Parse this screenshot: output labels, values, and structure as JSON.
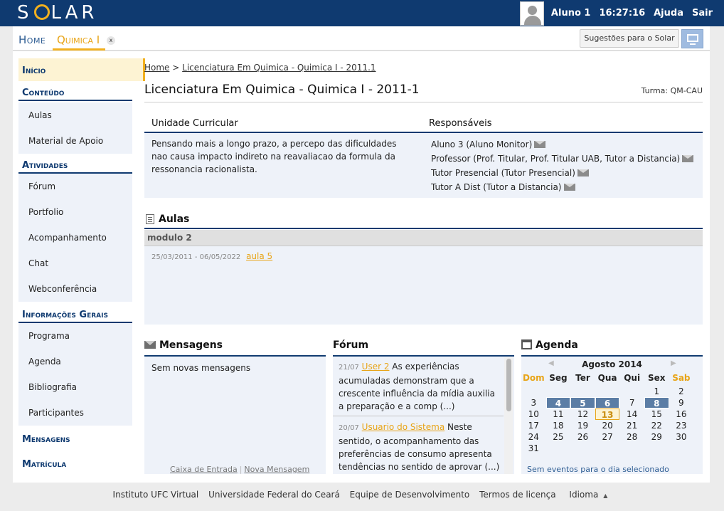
{
  "app": {
    "logo_text": "SOLAR"
  },
  "user": {
    "name": "Aluno 1",
    "time": "16:27:16",
    "help": "Ajuda",
    "logout": "Sair"
  },
  "tabs": {
    "home": "Home",
    "course": "Quimica I",
    "close": "x"
  },
  "toolbar": {
    "suggestions": "Sugestões para o Solar 2.0"
  },
  "sidebar": {
    "start": "Início",
    "content_title": "Conteúdo",
    "content_items": [
      "Aulas",
      "Material de Apoio"
    ],
    "activities_title": "Atividades",
    "activities_items": [
      "Fórum",
      "Portfolio",
      "Acompanhamento",
      "Chat",
      "Webconferência"
    ],
    "info_title": "Informações Gerais",
    "info_items": [
      "Programa",
      "Agenda",
      "Bibliografia",
      "Participantes"
    ],
    "messages": "Mensagens",
    "enrollment": "Matrícula"
  },
  "breadcrumb": {
    "home": "Home",
    "sep": ">",
    "course": "Licenciatura Em Quimica - Quimica I - 2011.1"
  },
  "page": {
    "title": "Licenciatura Em Quimica - Quimica I - 2011-1",
    "turma": "Turma:  QM-CAU"
  },
  "curricular": {
    "unit_header": "Unidade Curricular",
    "resp_header": "Responsáveis",
    "description": "Pensando mais a longo prazo, a percepo das dificuldades nao causa impacto indireto na reavaliacao da formula da ressonancia racionalista.",
    "responsibles": [
      "Aluno 3 (Aluno Monitor)",
      "Professor (Prof. Titular, Prof. Titular UAB, Tutor a Distancia)",
      "Tutor Presencial (Tutor Presencial)",
      "Tutor A Dist (Tutor a Distancia)"
    ]
  },
  "aulas": {
    "title": "Aulas",
    "module": "modulo 2",
    "date_range": "25/03/2011 - 06/05/2022",
    "lesson": "aula 5"
  },
  "messages": {
    "title": "Mensagens",
    "empty": "Sem novas mensagens",
    "inbox": "Caixa de Entrada",
    "new": "Nova Mensagem",
    "sep": "|"
  },
  "forum": {
    "title": "Fórum",
    "posts": [
      {
        "date": "21/07",
        "user": "User 2",
        "text": "As experiências acumuladas demonstram que a crescente influência da mídia auxilia a preparação e a comp (...)"
      },
      {
        "date": "20/07",
        "user": "Usuario do Sistema",
        "text": "Neste sentido, o acompanhamento das preferências de consumo apresenta tendências no sentido de aprovar (...)"
      }
    ]
  },
  "agenda": {
    "title": "Agenda",
    "month": "Agosto 2014",
    "prev": "◀",
    "next": "▶",
    "weekdays": [
      "Dom",
      "Seg",
      "Ter",
      "Qua",
      "Qui",
      "Sex",
      "Sab"
    ],
    "weeks": [
      [
        "",
        "",
        "",
        "",
        "",
        "1",
        "2"
      ],
      [
        "3",
        "4",
        "5",
        "6",
        "7",
        "8",
        "9"
      ],
      [
        "10",
        "11",
        "12",
        "13",
        "14",
        "15",
        "16"
      ],
      [
        "17",
        "18",
        "19",
        "20",
        "21",
        "22",
        "23"
      ],
      [
        "24",
        "25",
        "26",
        "27",
        "28",
        "29",
        "30"
      ],
      [
        "31",
        "",
        "",
        "",
        "",
        "",
        ""
      ]
    ],
    "event_days": [
      "4",
      "5",
      "6",
      "8"
    ],
    "today": "13",
    "no_events": "Sem eventos para o dia selecionado"
  },
  "footer": {
    "links": [
      "Instituto UFC Virtual",
      "Universidade Federal do Ceará",
      "Equipe de Desenvolvimento",
      "Termos de licença",
      "Idioma"
    ]
  },
  "colors": {
    "brand": "#0f3a70",
    "accent": "#f2b01e",
    "panel_bg": "#eef2f9",
    "event_day": "#5b7da5"
  }
}
